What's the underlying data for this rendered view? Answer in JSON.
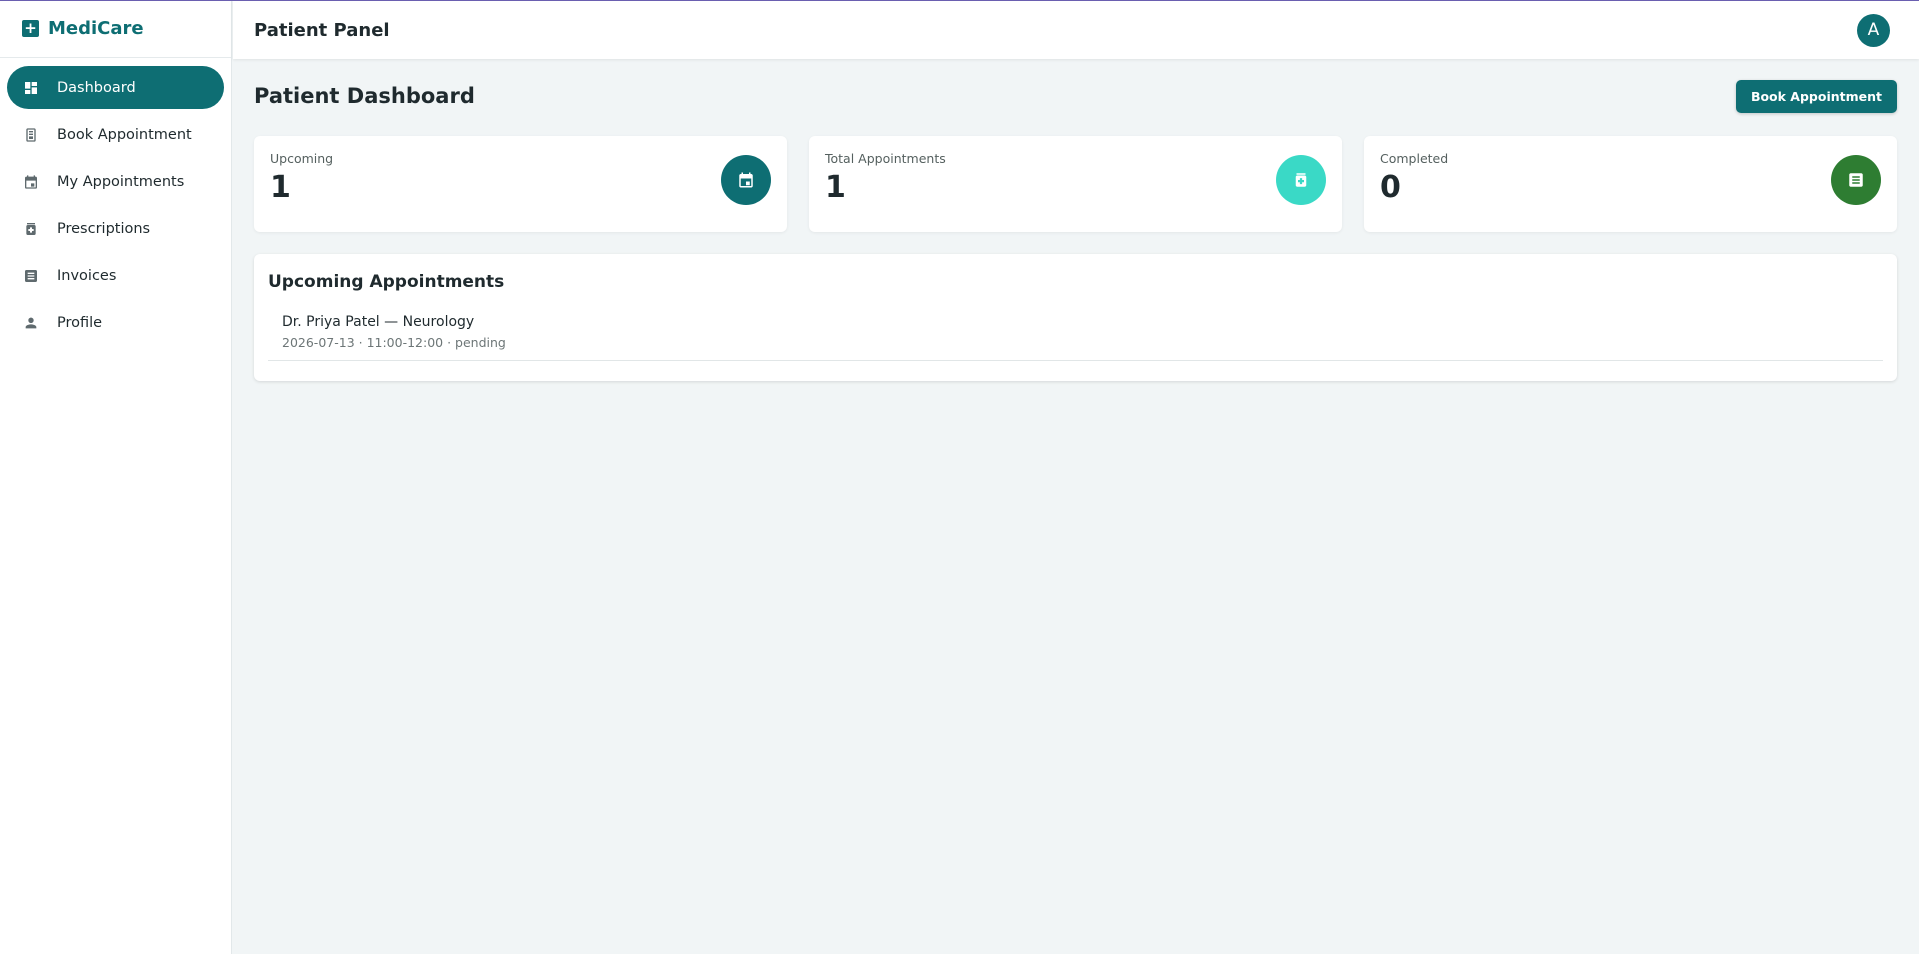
{
  "brand": {
    "name": "MediCare",
    "icon": "plus-cross-icon"
  },
  "sidebar": {
    "items": [
      {
        "label": "Dashboard",
        "icon": "dashboard-icon",
        "active": true
      },
      {
        "label": "Book Appointment",
        "icon": "clipboard-icon",
        "active": false
      },
      {
        "label": "My Appointments",
        "icon": "calendar-icon",
        "active": false
      },
      {
        "label": "Prescriptions",
        "icon": "medication-icon",
        "active": false
      },
      {
        "label": "Invoices",
        "icon": "list-icon",
        "active": false
      },
      {
        "label": "Profile",
        "icon": "person-icon",
        "active": false
      }
    ]
  },
  "header": {
    "title": "Patient Panel",
    "avatar_initial": "A"
  },
  "page": {
    "title": "Patient Dashboard",
    "book_button": "Book Appointment"
  },
  "stats": [
    {
      "label": "Upcoming",
      "value": "1",
      "icon": "calendar-icon",
      "color": "#0e6e73"
    },
    {
      "label": "Total Appointments",
      "value": "1",
      "icon": "medication-icon",
      "color": "#3ad9c6"
    },
    {
      "label": "Completed",
      "value": "0",
      "icon": "list-icon",
      "color": "#2e7d32"
    }
  ],
  "upcoming": {
    "title": "Upcoming Appointments",
    "items": [
      {
        "doctor": "Dr. Priya Patel — Neurology",
        "details": "2026-07-13 · 11:00-12:00 · pending"
      }
    ]
  },
  "colors": {
    "primary": "#0e6e73",
    "background": "#f1f5f6"
  }
}
